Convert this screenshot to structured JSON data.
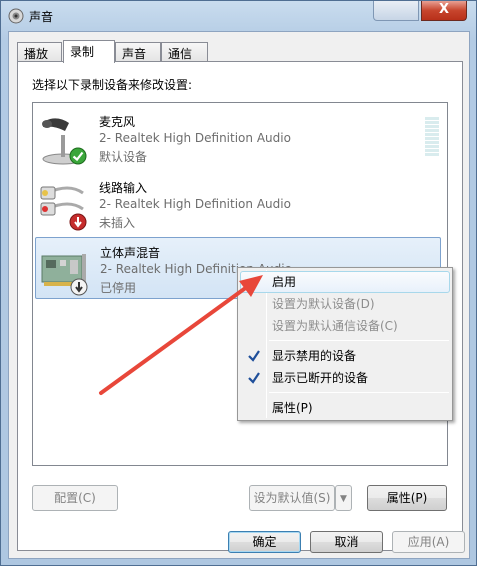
{
  "window": {
    "title": "声音",
    "close_label": "X"
  },
  "tabs": [
    "播放",
    "录制",
    "声音",
    "通信"
  ],
  "instruction": "选择以下录制设备来修改设置:",
  "devices": [
    {
      "name": "麦克风",
      "driver": "2- Realtek High Definition Audio",
      "status": "默认设备",
      "icon": "microphone-icon",
      "badge": "check-badge-icon"
    },
    {
      "name": "线路输入",
      "driver": "2- Realtek High Definition Audio",
      "status": "未插入",
      "icon": "line-in-cable-icon",
      "badge": "unplugged-badge-icon"
    },
    {
      "name": "立体声混音",
      "driver": "2- Realtek High Definition Audio",
      "status": "已停用",
      "icon": "sound-card-icon",
      "badge": "disabled-badge-icon"
    }
  ],
  "context_menu": {
    "items": [
      {
        "label": "启用",
        "state": "hover"
      },
      {
        "label": "设置为默认设备(D)",
        "state": "disabled"
      },
      {
        "label": "设置为默认通信设备(C)",
        "state": "disabled"
      },
      {
        "label": "显示禁用的设备",
        "state": "checked"
      },
      {
        "label": "显示已断开的设备",
        "state": "checked"
      },
      {
        "label": "属性(P)",
        "state": "normal"
      }
    ]
  },
  "buttons": {
    "configure": "配置(C)",
    "set_default": "设为默认值(S)",
    "properties": "属性(P)",
    "ok": "确定",
    "cancel": "取消",
    "apply": "应用(A)"
  },
  "colors": {
    "annotation_arrow": "#e8473a",
    "selection": "#d3e4f5"
  }
}
